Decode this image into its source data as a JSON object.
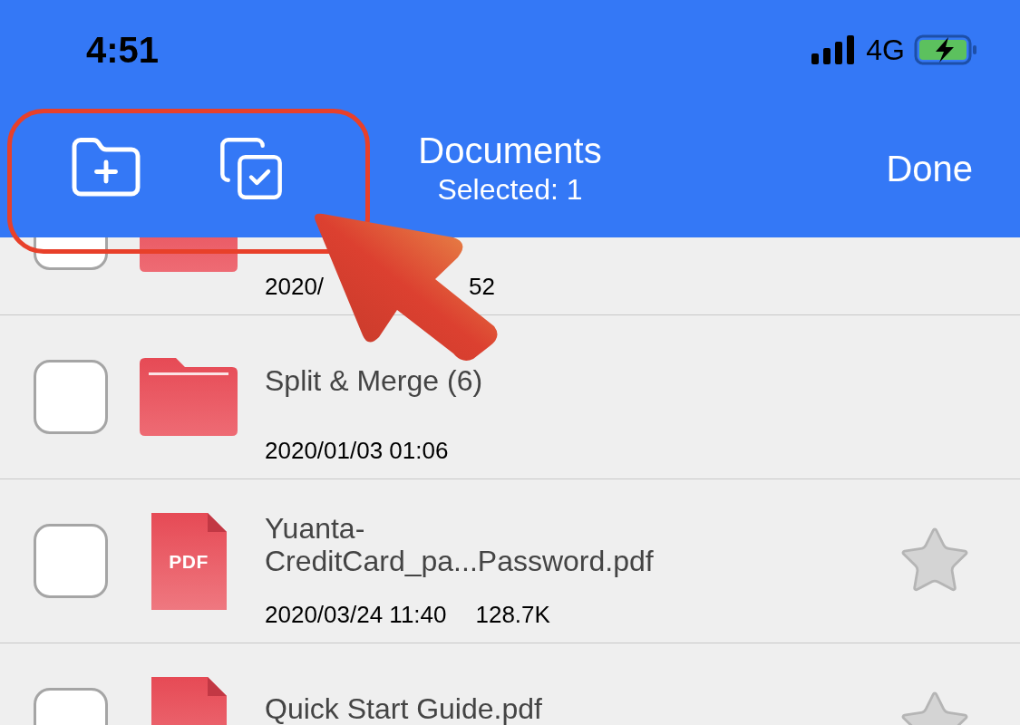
{
  "status_bar": {
    "time": "4:51",
    "network": "4G"
  },
  "nav_bar": {
    "title": "Documents",
    "subtitle": "Selected: 1",
    "done_button": "Done"
  },
  "rows": [
    {
      "kind": "folder",
      "checked": false,
      "date_parts": [
        "2020/",
        "52"
      ]
    },
    {
      "kind": "folder",
      "checked": false,
      "title": "Split & Merge (6)",
      "date": "2020/01/03 01:06"
    },
    {
      "kind": "pdf",
      "checked": false,
      "icon_label": "PDF",
      "title": "Yuanta-CreditCard_pa...Password.pdf",
      "date": "2020/03/24 11:40",
      "size": "128.7K",
      "starred": false
    },
    {
      "kind": "pdf",
      "checked": false,
      "title": "Quick Start Guide.pdf",
      "starred": false
    }
  ]
}
